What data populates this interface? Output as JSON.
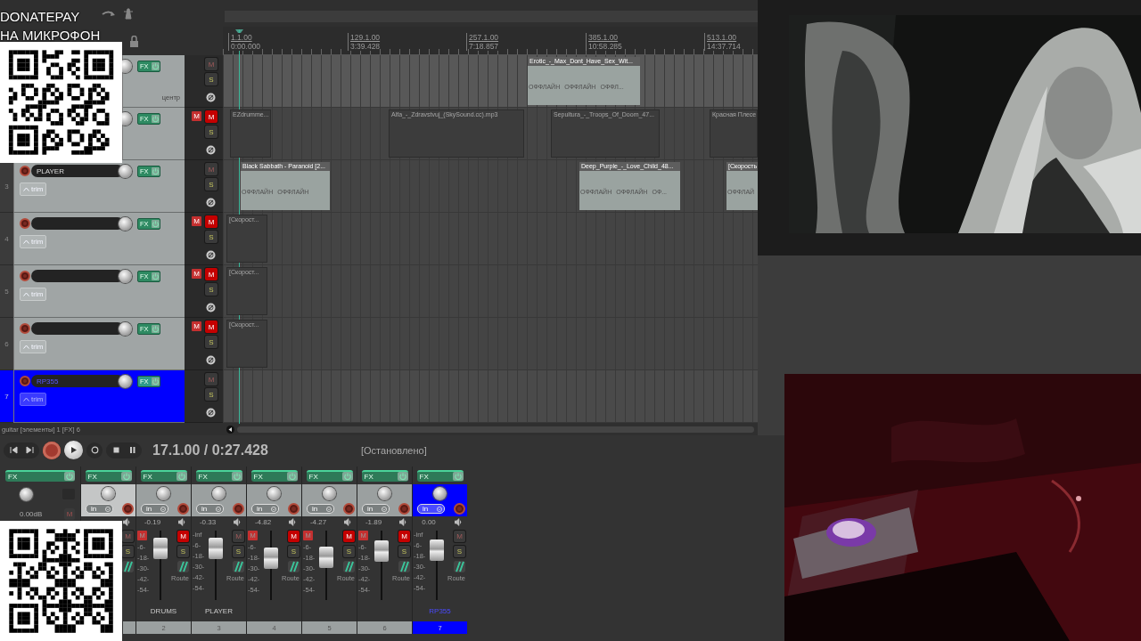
{
  "overlay": {
    "donate_lines": [
      "DONATEPAY",
      "НА МИКРОФОН"
    ]
  },
  "ruler": [
    {
      "measure": "1.1.00",
      "time": "0:00.000"
    },
    {
      "measure": "129.1.00",
      "time": "3:39.428"
    },
    {
      "measure": "257.1.00",
      "time": "7:18.857"
    },
    {
      "measure": "385.1.00",
      "time": "10:58.285"
    },
    {
      "measure": "513.1.00",
      "time": "14:37.714"
    }
  ],
  "tracks": [
    {
      "selected": false,
      "name_field": false,
      "pan_label": "центр",
      "fx": "FX",
      "mute": "M",
      "solo": "S",
      "muted": false,
      "items": [
        {
          "kind": "offline",
          "title": "Erotic_-_Max_Dont_Have_Sex_Wit...",
          "labels": [
            "ОФФЛАЙН",
            "ОФФЛАЙН",
            "ОФФЛ..."
          ]
        }
      ]
    },
    {
      "selected": false,
      "name_field": false,
      "fx": "FX",
      "mute": "M",
      "mute_flag": "M",
      "solo": "S",
      "muted": true,
      "items": [
        {
          "kind": "empty",
          "title": "EZdrumme..."
        },
        {
          "kind": "empty",
          "title": "Alfa_-_Zdravstvuj_(SkySound.cc).mp3"
        },
        {
          "kind": "empty",
          "title": "Sepultura_-_Troops_Of_Doom_47..."
        },
        {
          "kind": "empty",
          "title": "Красная Плесе"
        }
      ]
    },
    {
      "number": "3",
      "selected": false,
      "name_field": true,
      "name": "PLAYER",
      "trim": "trim",
      "fx": "FX",
      "mute": "M",
      "solo": "S",
      "muted": false,
      "items": [
        {
          "kind": "offline",
          "title": "Black Sabbath - Paranoid [2...",
          "labels": [
            "ОФФЛАЙН",
            "ОФФЛАЙН"
          ]
        },
        {
          "kind": "offline",
          "title": "Deep_Purple_-_Love_Child_48...",
          "labels": [
            "ОФФЛАЙН",
            "ОФФЛАЙН",
            "ОФ..."
          ]
        },
        {
          "kind": "offline",
          "title": "[Скорость",
          "labels": [
            "ОФФЛАЙ"
          ]
        }
      ]
    },
    {
      "number": "4",
      "selected": false,
      "name_field": true,
      "trim": "trim",
      "fx": "FX",
      "mute": "M",
      "mute_flag": "M",
      "solo": "S",
      "muted": true,
      "items": [
        {
          "kind": "empty",
          "title": "[Скорост..."
        }
      ]
    },
    {
      "number": "5",
      "selected": false,
      "name_field": true,
      "trim": "trim",
      "fx": "FX",
      "mute": "M",
      "mute_flag": "M",
      "solo": "S",
      "muted": true,
      "items": [
        {
          "kind": "empty",
          "title": "[Скорост..."
        }
      ]
    },
    {
      "number": "6",
      "selected": false,
      "name_field": true,
      "trim": "trim",
      "fx": "FX",
      "mute": "M",
      "mute_flag": "M",
      "solo": "S",
      "muted": true,
      "items": [
        {
          "kind": "empty",
          "title": "[Скорост..."
        }
      ]
    },
    {
      "number": "7",
      "selected": true,
      "name_field": true,
      "name": "RP355",
      "trim": "trim",
      "fx": "FX",
      "mute": "M",
      "solo": "S",
      "muted": false
    }
  ],
  "status_line": "guitar [элементы] 1 [FX] 6",
  "transport": {
    "time": "17.1.00 / 0:27.428",
    "state": "[Остановлено]"
  },
  "mixer": {
    "master": {
      "fx": "FX",
      "volume": "0.00dB",
      "mute": "M"
    },
    "strips": [
      {
        "selected": false,
        "fx": "FX",
        "input": "in",
        "mute": "M",
        "solo": "S",
        "muted": false
      },
      {
        "selected": false,
        "fx": "FX",
        "input": "in",
        "volume": "-0.19",
        "mute_flag": "M",
        "scale": [
          "-6-",
          "-18-",
          "-30-",
          "-42-",
          "-54-"
        ],
        "level": 0.75,
        "mute": "M",
        "solo": "S",
        "muted": true,
        "route": "Route",
        "name": "DRUMS",
        "number": "2"
      },
      {
        "selected": false,
        "fx": "FX",
        "input": "in",
        "volume": "-0.33",
        "peak": "-inf",
        "scale": [
          "-6-",
          "-18-",
          "-30-",
          "-42-",
          "-54-"
        ],
        "level": 0.75,
        "mute": "M",
        "solo": "S",
        "muted": false,
        "route": "Route",
        "name": "PLAYER",
        "number": "3"
      },
      {
        "selected": false,
        "fx": "FX",
        "input": "in",
        "volume": "-4.82",
        "mute_flag": "M",
        "scale": [
          "-6-",
          "-18-",
          "-30-",
          "-42-",
          "-54-"
        ],
        "level": 0.6,
        "mute": "M",
        "solo": "S",
        "muted": true,
        "route": "Route",
        "number": "4"
      },
      {
        "selected": false,
        "fx": "FX",
        "input": "in",
        "volume": "-4.27",
        "mute_flag": "M",
        "scale": [
          "-6-",
          "-18-",
          "-30-",
          "-42-",
          "-54-"
        ],
        "level": 0.62,
        "mute": "M",
        "solo": "S",
        "muted": true,
        "route": "Route",
        "number": "5"
      },
      {
        "selected": false,
        "fx": "FX",
        "input": "in",
        "volume": "-1.89",
        "mute_flag": "M",
        "scale": [
          "-6-",
          "-18-",
          "-30-",
          "-42-",
          "-54-"
        ],
        "level": 0.7,
        "mute": "M",
        "solo": "S",
        "muted": true,
        "route": "Route",
        "number": "6"
      },
      {
        "selected": true,
        "fx": "FX",
        "input": "in",
        "volume": "0.00",
        "peak": "-inf",
        "scale": [
          "-6-",
          "-18-",
          "-30-",
          "-42-",
          "-54-"
        ],
        "level": 0.72,
        "mute": "M",
        "solo": "S",
        "muted": false,
        "route": "Route",
        "name": "RP355",
        "number": "7"
      }
    ]
  }
}
